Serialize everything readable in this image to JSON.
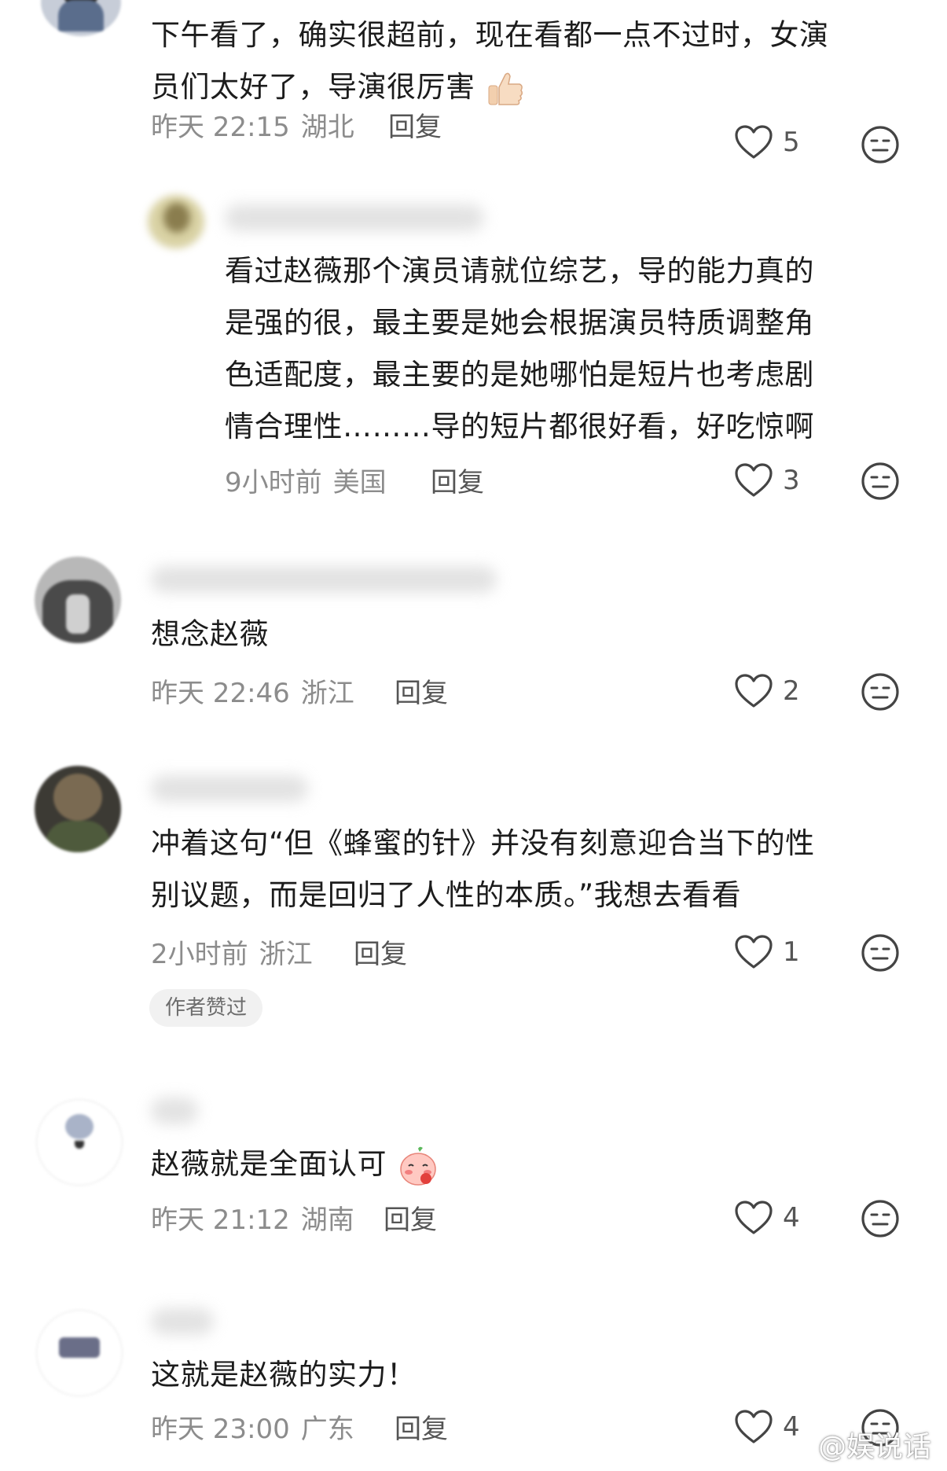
{
  "comments": [
    {
      "text_line1": "下午看了，确实很超前，现在看都一点不过时，女演",
      "text_line2": "员们太好了，导演很厉害",
      "time": "昨天 22:15",
      "location": "湖北",
      "reply_label": "回复",
      "likes": "5",
      "reply": {
        "text_line1": "看过赵薇那个演员请就位综艺，导的能力真的",
        "text_line2": "是强的很，最主要是她会根据演员特质调整角",
        "text_line3": "色适配度，最主要的是她哪怕是短片也考虑剧",
        "text_line4": "情合理性………导的短片都很好看，好吃惊啊",
        "time": "9小时前",
        "location": "美国",
        "reply_label": "回复",
        "likes": "3"
      }
    },
    {
      "text_line1": "想念赵薇",
      "time": "昨天 22:46",
      "location": "浙江",
      "reply_label": "回复",
      "likes": "2"
    },
    {
      "text_line1": "冲着这句“但《蜂蜜的针》并没有刻意迎合当下的性",
      "text_line2": "别议题，而是回归了人性的本质。”我想去看看",
      "time": "2小时前",
      "location": "浙江",
      "reply_label": "回复",
      "likes": "1",
      "badge": "作者赞过"
    },
    {
      "text_line1": "赵薇就是全面认可",
      "time": "昨天 21:12",
      "location": "湖南",
      "reply_label": "回复",
      "likes": "4"
    },
    {
      "text_line1": "这就是赵薇的实力！",
      "time": "昨天 23:00",
      "location": "广东",
      "reply_label": "回复",
      "likes": "4"
    }
  ],
  "watermark": "@娱说话",
  "icons": {
    "like": "heart-outline-icon",
    "dislike": "neutral-face-icon",
    "thumbs_up_emoji": "thumbs-up-emoji-icon",
    "blush_emoji": "blushing-face-emoji-icon"
  },
  "colors": {
    "text": "#1c1c1c",
    "meta": "#8c8c8c",
    "icon": "#444444"
  }
}
